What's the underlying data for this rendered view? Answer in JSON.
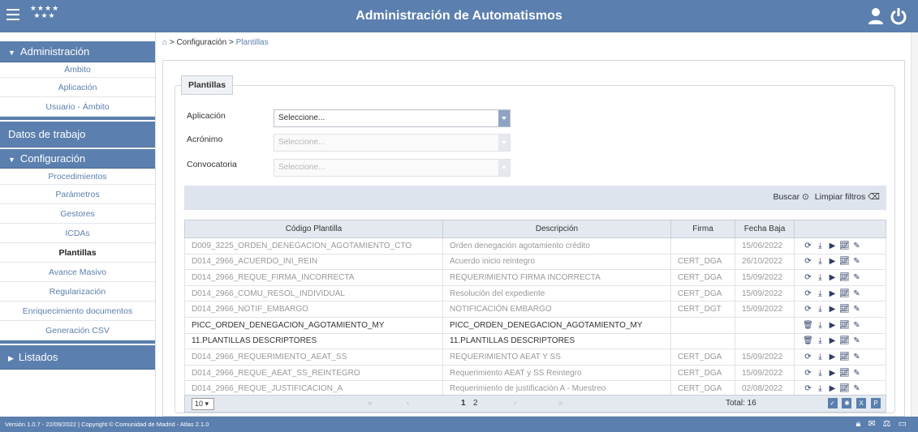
{
  "header": {
    "title": "Administración de Automatismos",
    "logo_stars": "★★★★ ★★★"
  },
  "sidebar": {
    "sections": [
      {
        "label": "Administración",
        "expanded": true,
        "items": [
          "Ámbito",
          "Aplicación",
          "Usuario - Ámbito"
        ]
      },
      {
        "label": "Datos de trabajo",
        "expanded": false,
        "items": []
      },
      {
        "label": "Configuración",
        "expanded": true,
        "items": [
          "Procedimientos",
          "Parámetros",
          "Gestores",
          "ICDAs",
          "Plantillas",
          "Avance Masivo",
          "Regularización",
          "Enriquecimiento documentos",
          "Generación CSV"
        ]
      },
      {
        "label": "Listados",
        "expanded": false,
        "items": []
      }
    ],
    "active_item": "Plantillas"
  },
  "breadcrumb": {
    "part1": "Configuración",
    "current": "Plantillas"
  },
  "panel": {
    "legend": "Plantillas"
  },
  "form": {
    "aplicacion_label": "Aplicación",
    "aplicacion_value": "Seleccione...",
    "acronimo_label": "Acrónimo",
    "acronimo_value": "Seleccione...",
    "convocatoria_label": "Convocatoria",
    "convocatoria_value": "Seleccione..."
  },
  "filters": {
    "buscar": "Buscar",
    "limpiar": "Limpiar filtros"
  },
  "table": {
    "headers": [
      "Código Plantilla",
      "Descripción",
      "Firma",
      "Fecha Baja",
      ""
    ],
    "rows": [
      {
        "codigo": "D009_3225_ORDEN_DENEGACION_AGOTAMIENTO_CTO",
        "descripcion": "Orden denegación agotamiento crédito",
        "firma": "",
        "fecha": "15/06/2022",
        "dark": false
      },
      {
        "codigo": "D014_2966_ACUERDO_INI_REIN",
        "descripcion": "Acuerdo inicio reintegro",
        "firma": "CERT_DGA",
        "fecha": "26/10/2022",
        "dark": false
      },
      {
        "codigo": "D014_2966_REQUE_FIRMA_INCORRECTA",
        "descripcion": "REQUERIMIENTO FIRMA INCORRECTA",
        "firma": "CERT_DGA",
        "fecha": "15/09/2022",
        "dark": false
      },
      {
        "codigo": "D014_2966_COMU_RESOL_INDIVIDUAL",
        "descripcion": "Resolución del expediente",
        "firma": "CERT_DGA",
        "fecha": "15/09/2022",
        "dark": false
      },
      {
        "codigo": "D014_2966_NOTIF_EMBARGO",
        "descripcion": "NOTIFICACIÓN EMBARGO",
        "firma": "CERT_DGT",
        "fecha": "15/09/2022",
        "dark": false
      },
      {
        "codigo": "PICC_ORDEN_DENEGACION_AGOTAMIENTO_MY",
        "descripcion": "PICC_ORDEN_DENEGACION_AGOTAMIENTO_MY",
        "firma": "",
        "fecha": "",
        "dark": true
      },
      {
        "codigo": "11.PLANTILLAS DESCRIPTORES",
        "descripcion": "11.PLANTILLAS DESCRIPTORES",
        "firma": "",
        "fecha": "",
        "dark": true
      },
      {
        "codigo": "D014_2966_REQUERIMIENTO_AEAT_SS",
        "descripcion": "REQUERIMIENTO AEAT Y SS",
        "firma": "CERT_DGA",
        "fecha": "15/09/2022",
        "dark": false
      },
      {
        "codigo": "D014_2966_REQUE_AEAT_SS_REINTEGRO",
        "descripcion": "Requerimiento AEAT y SS Reintegro",
        "firma": "CERT_DGA",
        "fecha": "15/09/2022",
        "dark": false
      },
      {
        "codigo": "D014_2966_REQUE_JUSTIFICACION_A",
        "descripcion": "Requerimiento de justificación A - Muestreo",
        "firma": "CERT_DGA",
        "fecha": "02/08/2022",
        "dark": false
      }
    ]
  },
  "pager": {
    "page_size": "10",
    "first": "«",
    "prev": "‹",
    "current": "1",
    "next_page": "2",
    "next": "›",
    "last": "»",
    "total": "Total: 16"
  },
  "footer": {
    "version": "Versión 1.0.7 - 22/09/2022 | Copyright © Comunidad de Madrid - Atlas 2.1.0"
  }
}
